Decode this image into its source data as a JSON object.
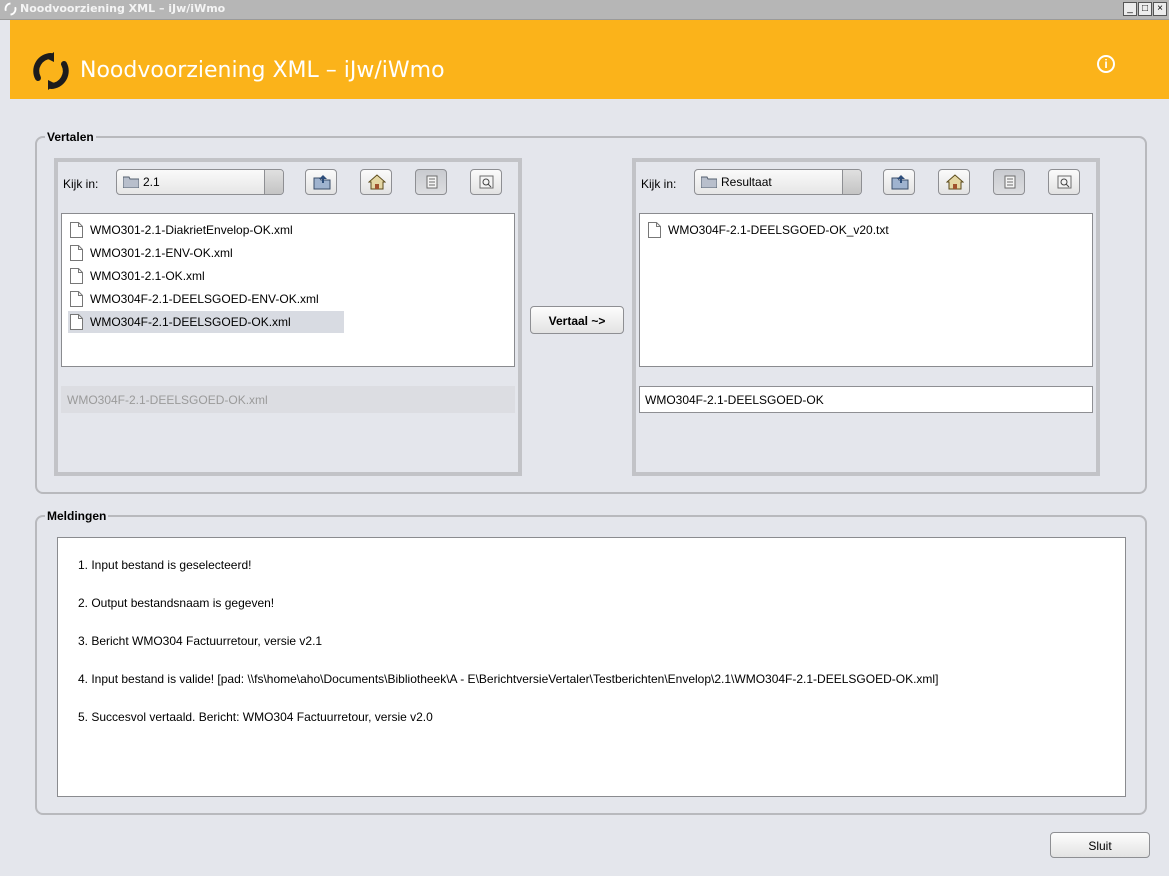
{
  "window": {
    "title": "Noodvoorziening XML – iJw/iWmo"
  },
  "header": {
    "title": "Noodvoorziening XML – iJw/iWmo",
    "info_glyph": "i"
  },
  "vertalen": {
    "legend": "Vertalen",
    "left": {
      "kijk_label": "Kijk in:",
      "folder": "2.1",
      "files": [
        "WMO301-2.1-DiakrietEnvelop-OK.xml",
        "WMO301-2.1-ENV-OK.xml",
        "WMO301-2.1-OK.xml",
        "WMO304F-2.1-DEELSGOED-ENV-OK.xml",
        "WMO304F-2.1-DEELSGOED-OK.xml"
      ],
      "selected_index": 4,
      "filename": "WMO304F-2.1-DEELSGOED-OK.xml"
    },
    "translate_button": "Vertaal ~>",
    "right": {
      "kijk_label": "Kijk in:",
      "folder": "Resultaat",
      "files": [
        "WMO304F-2.1-DEELSGOED-OK_v20.txt"
      ],
      "filename": "WMO304F-2.1-DEELSGOED-OK"
    }
  },
  "meldingen": {
    "legend": "Meldingen",
    "messages": [
      "1. Input bestand is geselecteerd!",
      "2. Output bestandsnaam is gegeven!",
      "3. Bericht WMO304 Factuurretour, versie v2.1",
      "4. Input bestand is valide! [pad: \\\\fs\\home\\aho\\Documents\\Bibliotheek\\A - E\\BerichtversieVertaler\\Testberichten\\Envelop\\2.1\\WMO304F-2.1-DEELSGOED-OK.xml]",
      "5. Succesvol vertaald. Bericht: WMO304 Factuurretour, versie v2.0"
    ]
  },
  "footer": {
    "close_button": "Sluit"
  },
  "colors": {
    "header": "#fbb31a",
    "background": "#e4e6ec",
    "selection": "#d8dbe2"
  }
}
